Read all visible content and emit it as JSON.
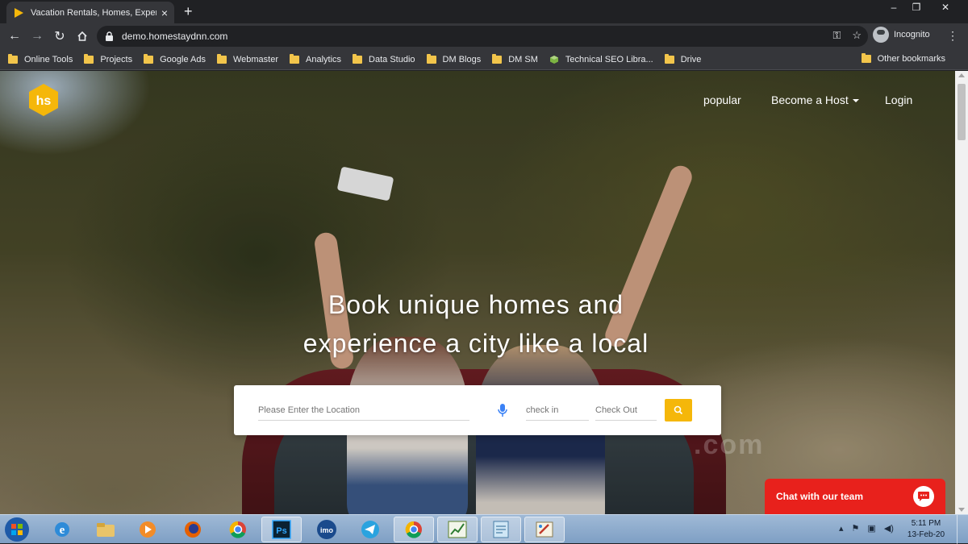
{
  "browser": {
    "tab": {
      "title": "Vacation Rentals, Homes, Experie",
      "close_icon": "close-icon"
    },
    "new_tab_label": "+",
    "window_controls": [
      "–",
      "❐",
      "✕"
    ],
    "url": "demo.homestaydnn.com",
    "profile_label": "Incognito",
    "nav_icons": [
      "back-arrow-icon",
      "forward-arrow-icon",
      "reload-icon",
      "home-icon"
    ],
    "omnibox_icons": [
      "key-icon",
      "star-icon"
    ],
    "bookmarks": [
      "Online Tools",
      "Projects",
      "Google Ads",
      "Webmaster",
      "Analytics",
      "Data Studio",
      "DM Blogs",
      "DM SM",
      "Technical SEO Libra...",
      "Drive"
    ],
    "other_bookmarks": "Other bookmarks"
  },
  "site": {
    "logo_text": "hs",
    "nav": {
      "popular": "popular",
      "become_host": "Become a Host",
      "login": "Login"
    },
    "headline": {
      "line1": "Book unique homes and",
      "line2": "experience a city like a local"
    },
    "search": {
      "location_placeholder": "Please Enter the Location",
      "checkin_placeholder": "check in",
      "checkout_placeholder": "Check Out"
    },
    "watermark": ".com",
    "chat_label": "Chat with our team",
    "colors": {
      "accent": "#f5b70a",
      "chat": "#e8211c"
    }
  },
  "taskbar": {
    "apps": [
      "windows-start-icon",
      "internet-explorer-icon",
      "file-explorer-icon",
      "media-player-icon",
      "firefox-icon",
      "chrome-icon",
      "photoshop-icon",
      "imo-icon",
      "telegram-icon",
      "chrome-icon",
      "chart-app-icon",
      "notepad-icon",
      "paint-icon"
    ],
    "photoshop_label": "Ps",
    "imo_label": "imo",
    "clock_time": "5:11 PM",
    "clock_date": "13-Feb-20"
  }
}
